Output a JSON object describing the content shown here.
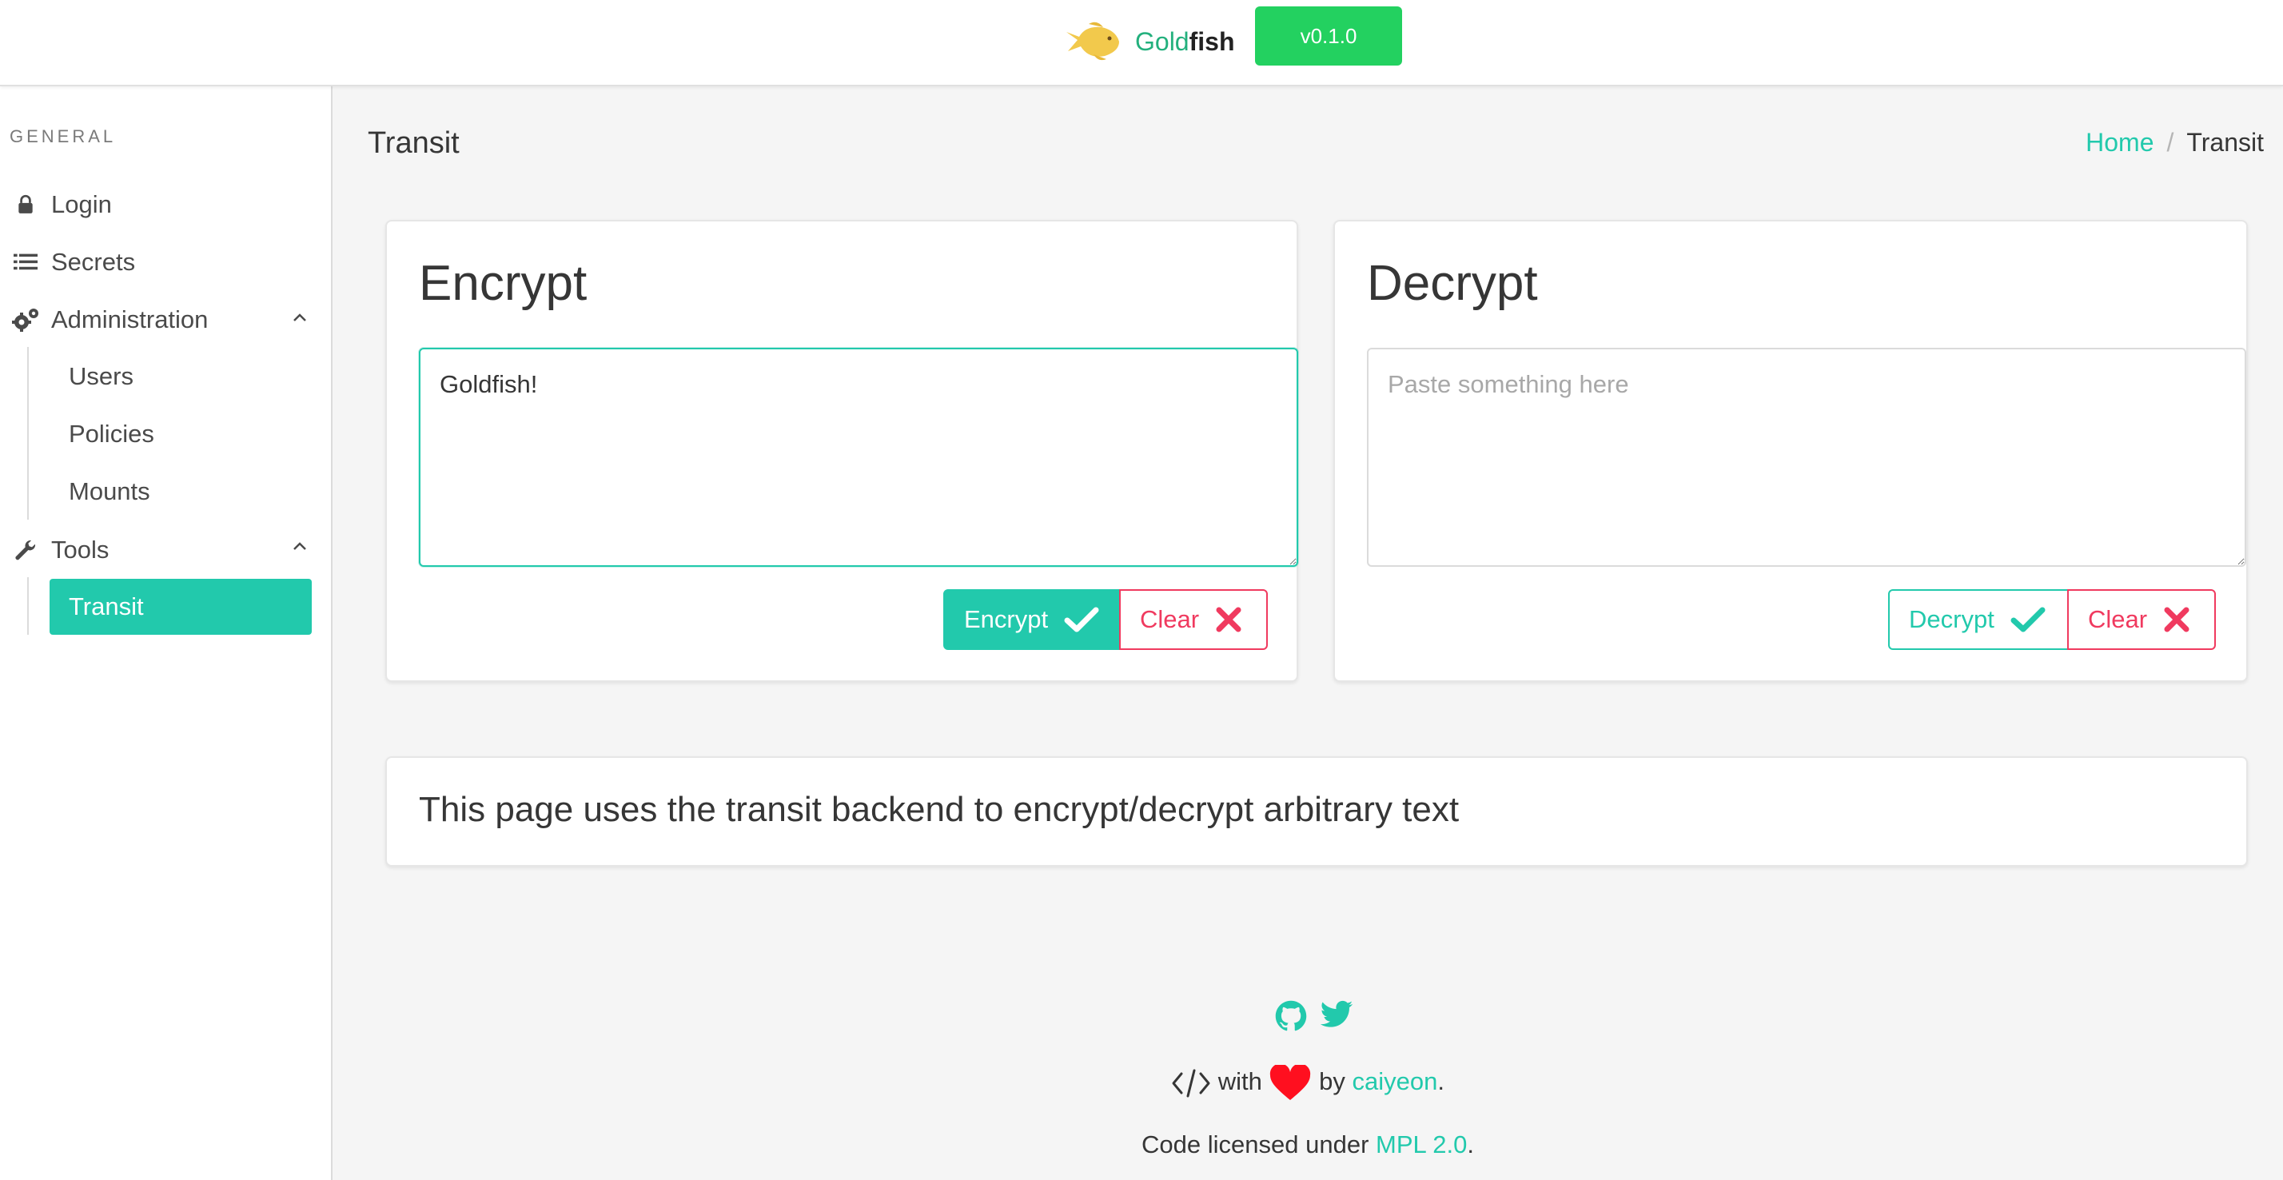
{
  "header": {
    "brand_gold": "Gold",
    "brand_fish": "fish",
    "version": "v0.1.0"
  },
  "sidebar": {
    "section_label": "GENERAL",
    "items": [
      {
        "label": "Login",
        "icon": "lock-icon"
      },
      {
        "label": "Secrets",
        "icon": "list-icon"
      },
      {
        "label": "Administration",
        "icon": "cogs-icon",
        "expanded": true,
        "children": [
          "Users",
          "Policies",
          "Mounts"
        ]
      },
      {
        "label": "Tools",
        "icon": "wrench-icon",
        "expanded": true,
        "children": [
          "Transit"
        ]
      }
    ],
    "active_item": "Transit"
  },
  "page": {
    "title": "Transit",
    "breadcrumb": {
      "home": "Home",
      "separator": "/",
      "current": "Transit"
    }
  },
  "encrypt": {
    "title": "Encrypt",
    "input_value": "Goldfish!",
    "encrypt_label": "Encrypt",
    "clear_label": "Clear"
  },
  "decrypt": {
    "title": "Decrypt",
    "placeholder": "Paste something here",
    "decrypt_label": "Decrypt",
    "clear_label": "Clear"
  },
  "note": "This page uses the transit backend to encrypt/decrypt arbitrary text",
  "footer": {
    "with": "with",
    "by": "by",
    "author": "caiyeon",
    "period": ".",
    "license_prefix": "Code licensed under",
    "license": "MPL 2.0",
    "license_suffix": "."
  },
  "colors": {
    "primary": "#22c9ac",
    "danger": "#f03a5f",
    "success_tag": "#23d160",
    "heart": "#ff0f1f"
  }
}
